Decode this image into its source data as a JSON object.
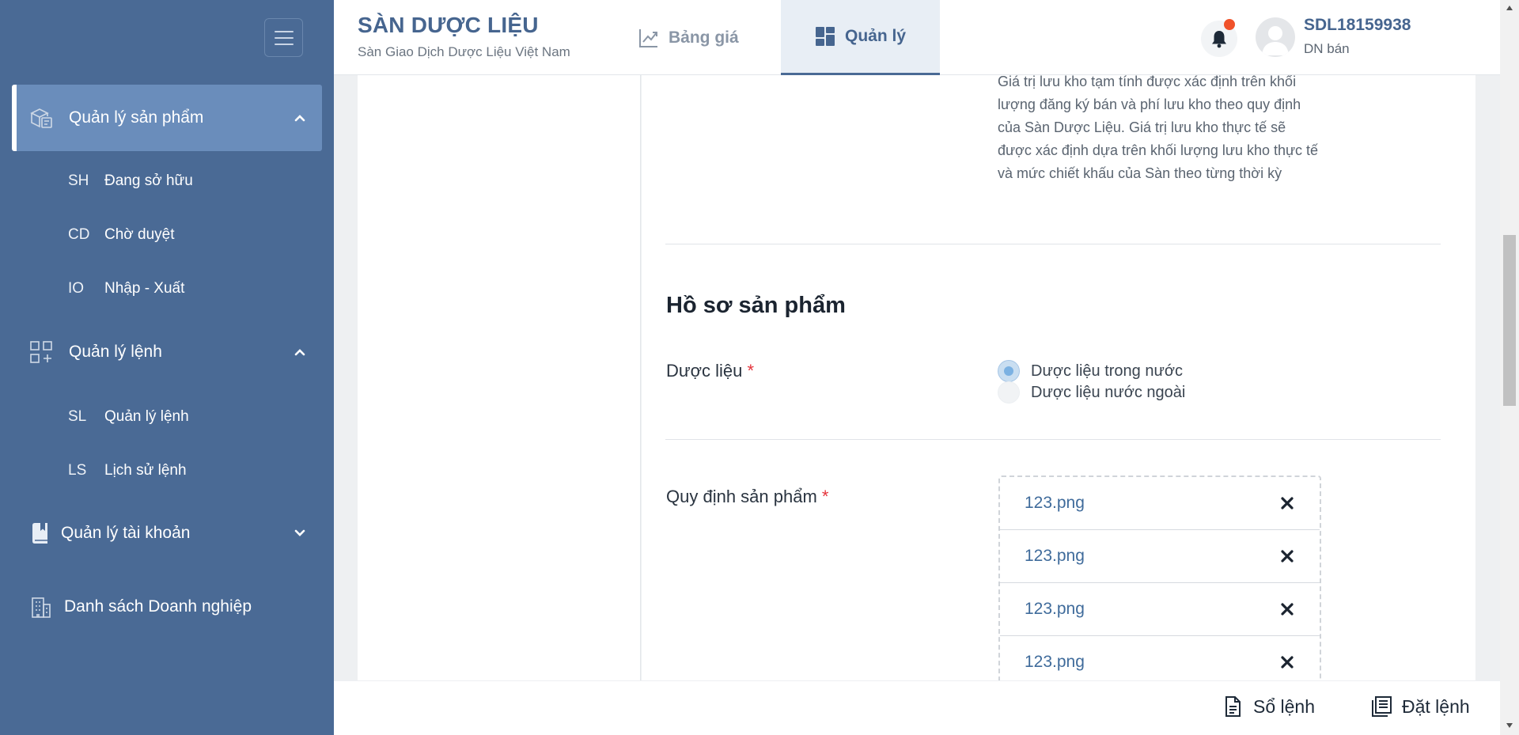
{
  "sidebar": {
    "groups": [
      {
        "label": "Quản lý sản phẩm",
        "icon": "product-box-icon",
        "expanded": true,
        "active": true
      },
      {
        "label": "Quản lý lệnh",
        "icon": "order-grid-icon",
        "expanded": true
      },
      {
        "label": "Quản lý tài khoản",
        "icon": "account-book-icon",
        "expanded": false
      },
      {
        "label": "Danh sách Doanh nghiệp",
        "icon": "building-icon"
      }
    ],
    "product_items": [
      {
        "abbr": "SH",
        "label": "Đang sở hữu"
      },
      {
        "abbr": "CD",
        "label": "Chờ duyệt"
      },
      {
        "abbr": "IO",
        "label": "Nhập - Xuất"
      }
    ],
    "order_items": [
      {
        "abbr": "SL",
        "label": "Quản lý lệnh"
      },
      {
        "abbr": "LS",
        "label": "Lịch sử lệnh"
      }
    ]
  },
  "header": {
    "brand_title": "SÀN DƯỢC LIỆU",
    "brand_subtitle": "Sàn Giao Dịch Dược Liệu Việt Nam",
    "tabs": [
      {
        "label": "Bảng giá",
        "icon": "chart-line-icon"
      },
      {
        "label": "Quản lý",
        "icon": "dashboard-icon",
        "active": true
      }
    ],
    "user": {
      "id": "SDL18159938",
      "role": "DN bán"
    }
  },
  "content": {
    "storage_note": "Giá trị lưu kho tạm tính được xác định trên khối lượng đăng ký bán và phí lưu kho theo quy định của Sàn Dược Liệu. Giá trị lưu kho thực tế sẽ được xác định dựa trên khối lượng lưu kho thực tế và mức chiết khấu của Sàn theo từng thời kỳ",
    "section_title": "Hồ sơ sản phẩm",
    "herb_field": {
      "label": "Dược liệu",
      "required_mark": "*",
      "options": [
        {
          "label": "Dược liệu trong nước",
          "selected": true
        },
        {
          "label": "Dược liệu nước ngoài",
          "selected": false
        }
      ]
    },
    "regulation_field": {
      "label": "Quy định sản phẩm",
      "required_mark": "*",
      "files": [
        "123.png",
        "123.png",
        "123.png",
        "123.png"
      ]
    }
  },
  "footer": {
    "order_book_label": "Sổ lệnh",
    "place_order_label": "Đặt lệnh"
  },
  "colors": {
    "sidebar_bg": "#4a6a95",
    "sidebar_active": "#6a8dbb",
    "brand": "#46658f",
    "required": "#e5343c",
    "notification": "#f0522a"
  }
}
